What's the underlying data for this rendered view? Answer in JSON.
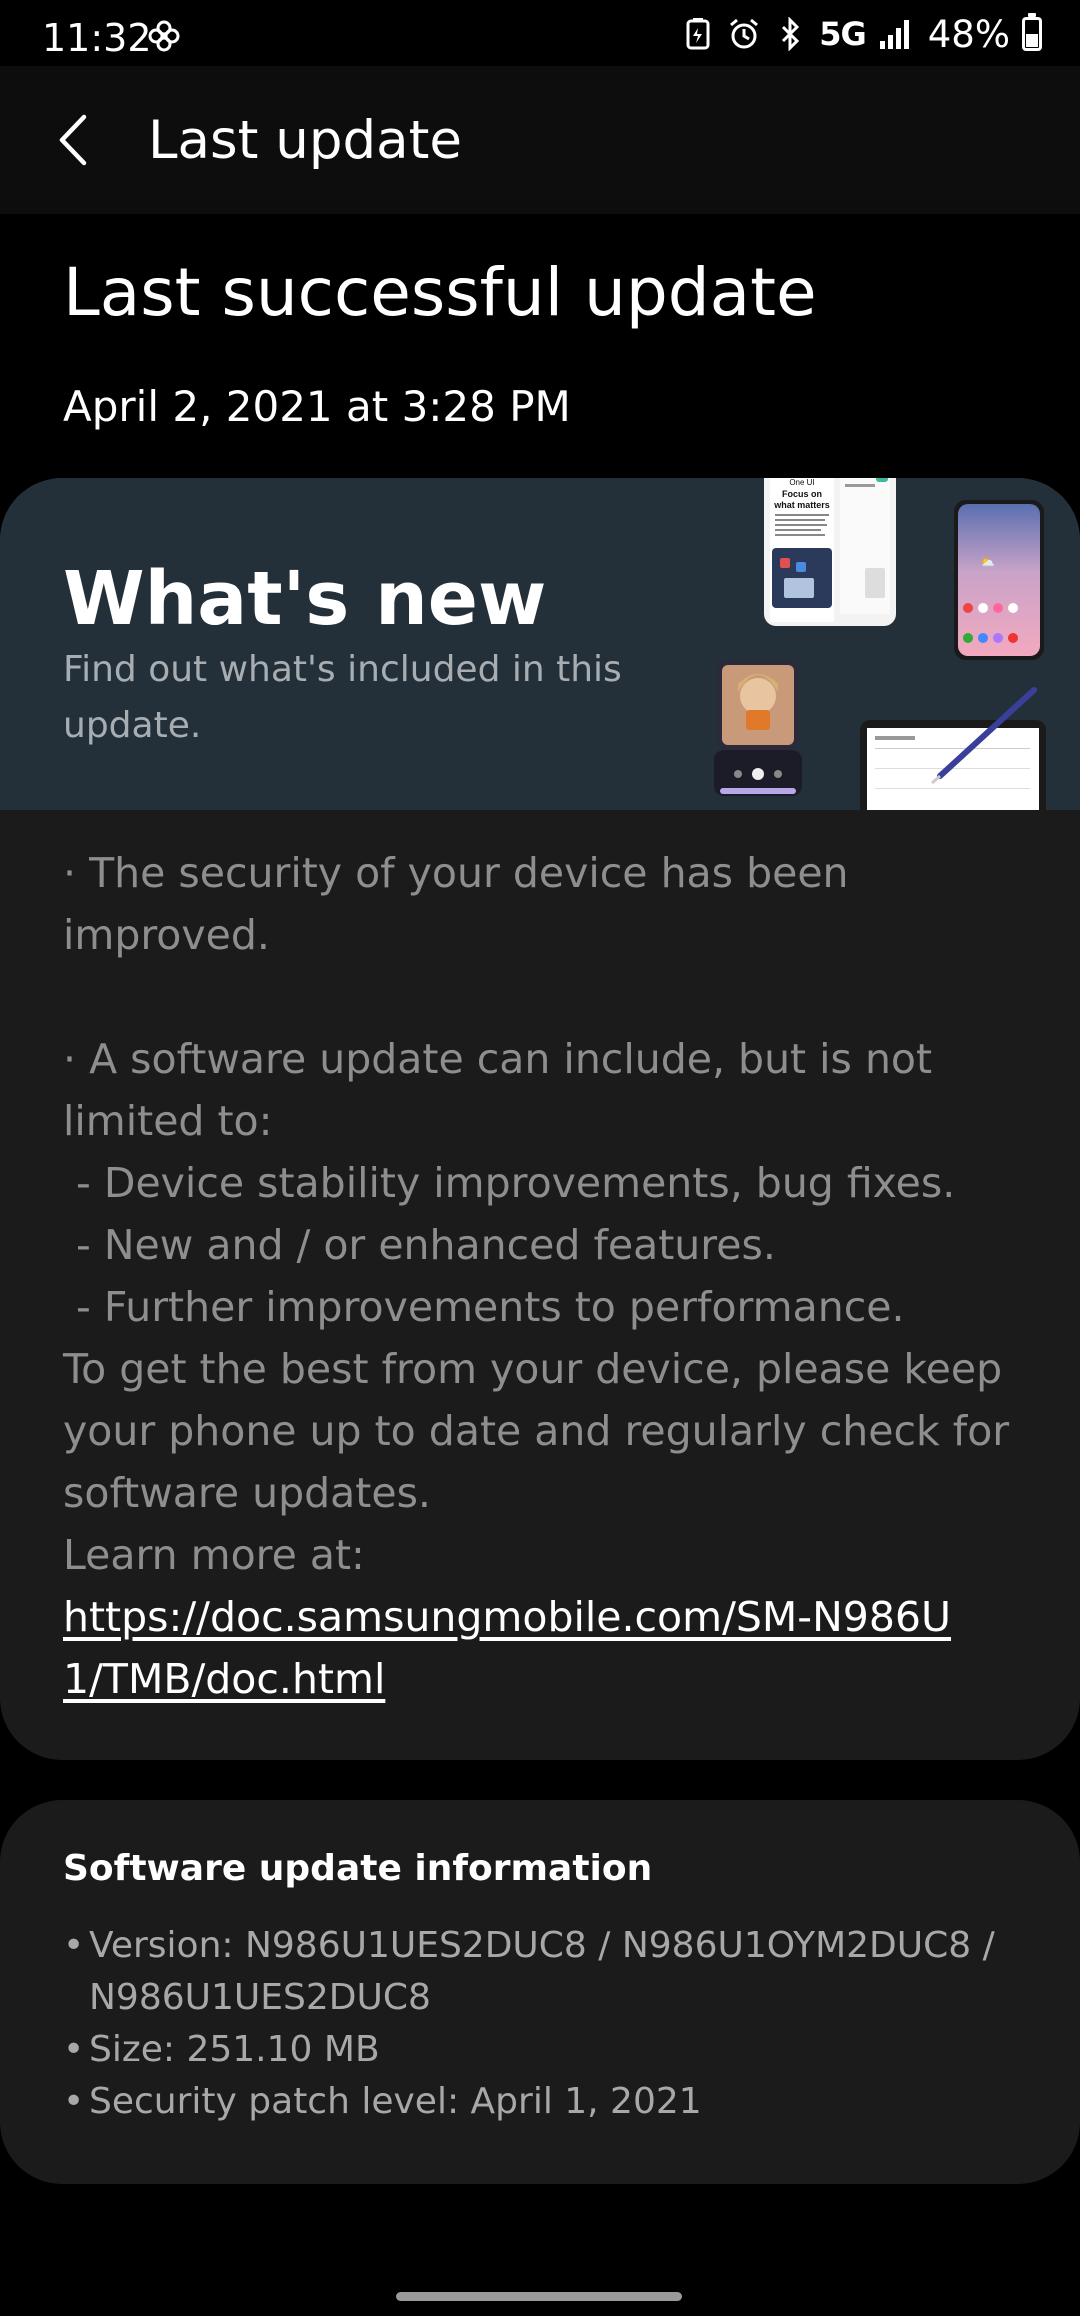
{
  "status_bar": {
    "time": "11:32",
    "left_icon": "pinwheel-icon",
    "network": "5G",
    "battery_text": "48%",
    "battery_level": 0.48
  },
  "app_bar": {
    "title": "Last update",
    "back_icon": "chevron-left-icon"
  },
  "header": {
    "title": "Last successful update",
    "date": "April 2, 2021 at 3:28 PM"
  },
  "whats_new": {
    "title": "What's new",
    "subtitle": "Find out what's included in this update.",
    "body": "· The security of your device has been improved.\n\n· A software update can include, but is not limited to:\n - Device stability improvements, bug fixes.\n - New and / or enhanced features.\n - Further improvements to performance.\nTo get the best from your device, please keep your phone up to date and regularly check for software updates.",
    "learn_more_label": "Learn more at:",
    "link": "https://doc.samsungmobile.com/SM-N986U1/TMB/doc.html",
    "illustration_text": {
      "one_ui": "One UI",
      "focus": "Focus on what matters"
    }
  },
  "software_info": {
    "title": "Software update information",
    "items": [
      "Version: N986U1UES2DUC8 / N986U1OYM2DUC8 / N986U1UES2DUC8",
      "Size: 251.10 MB",
      "Security patch level: April 1, 2021"
    ]
  },
  "colors": {
    "background": "#000000",
    "card": "#1b1b1b",
    "banner": "#243039",
    "muted_text": "#8e8e8e"
  }
}
